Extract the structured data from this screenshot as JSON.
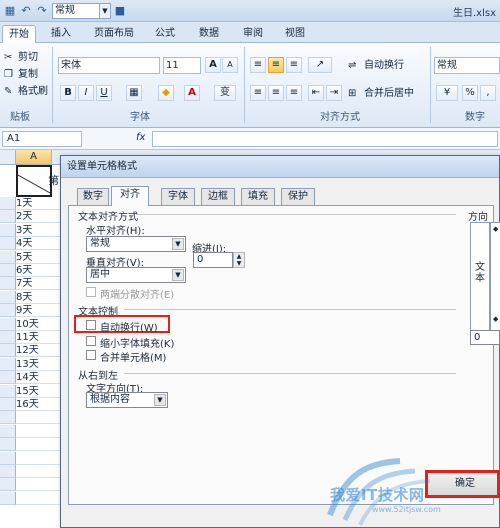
{
  "titlebar": {
    "format_combo": "常规",
    "doc_title": "生日.xlsx"
  },
  "tabs": [
    "开始",
    "插入",
    "页面布局",
    "公式",
    "数据",
    "审阅",
    "视图"
  ],
  "ribbon": {
    "clipboard": {
      "cut": "剪切",
      "copy": "复制",
      "format_painter": "格式刷",
      "label": "贴板"
    },
    "font": {
      "name": "宋体",
      "size": "11",
      "bold": "B",
      "italic": "I",
      "underline": "U",
      "label": "字体",
      "grow": "A",
      "shrink": "A"
    },
    "alignment": {
      "wrap_text": "自动换行",
      "merge_center": "合并后居中",
      "label": "对齐方式"
    },
    "number": {
      "format": "常规",
      "percent": "%",
      "comma": ",",
      "label": "数字"
    }
  },
  "formula": {
    "name_box": "A1",
    "fx": "fx"
  },
  "sheet": {
    "col_a": "A",
    "b1_text": "第",
    "rows": [
      "1天",
      "2天",
      "3天",
      "4天",
      "5天",
      "6天",
      "7天",
      "8天",
      "9天",
      "10天",
      "11天",
      "12天",
      "13天",
      "14天",
      "15天",
      "16天"
    ]
  },
  "dialog": {
    "title": "设置单元格格式",
    "tabs": [
      "数字",
      "对齐",
      "字体",
      "边框",
      "填充",
      "保护"
    ],
    "text_align_section": "文本对齐方式",
    "h_align_label": "水平对齐(H):",
    "h_align_value": "常规",
    "indent_label": "缩进(I):",
    "indent_value": "0",
    "v_align_label": "垂直对齐(V):",
    "v_align_value": "居中",
    "justify_distributed": "两端分散对齐(E)",
    "text_control_section": "文本控制",
    "wrap_text": "自动换行(W)",
    "shrink_fit": "缩小字体填充(K)",
    "merge_cells": "合并单元格(M)",
    "rtl_section": "从右到左",
    "text_direction_label": "文字方向(T):",
    "text_direction_value": "根据内容",
    "orientation_label": "方向",
    "orientation_text": "文本",
    "degree_value": "0",
    "ok": "确定"
  },
  "watermark": {
    "text": "我爱IT技术网",
    "sub": "www.52itjsw.com"
  }
}
